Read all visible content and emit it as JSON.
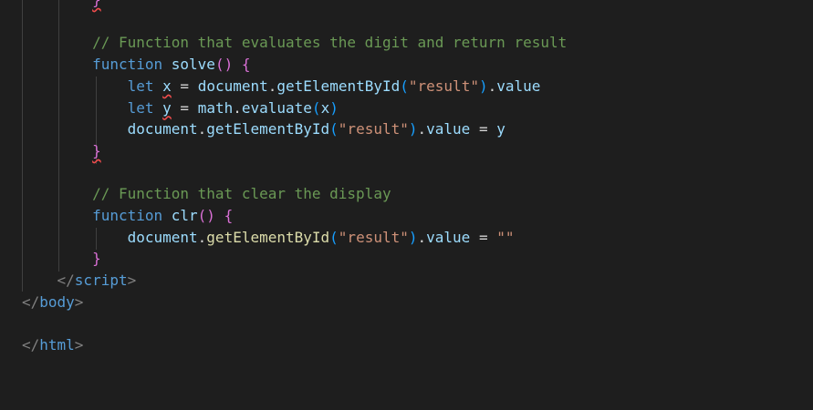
{
  "editor": {
    "lines": [
      {
        "indent": "        ",
        "tokens": [
          {
            "t": "}",
            "c": "br1 squig"
          }
        ]
      },
      {
        "indent": "",
        "tokens": []
      },
      {
        "indent": "        ",
        "tokens": [
          {
            "t": "// Function that evaluates the digit and return result",
            "c": "cm"
          }
        ]
      },
      {
        "indent": "        ",
        "tokens": [
          {
            "t": "function",
            "c": "kw"
          },
          {
            "t": " ",
            "c": "op"
          },
          {
            "t": "solve",
            "c": "var"
          },
          {
            "t": "()",
            "c": "br1"
          },
          {
            "t": " ",
            "c": "op"
          },
          {
            "t": "{",
            "c": "br1"
          }
        ]
      },
      {
        "indent": "            ",
        "tokens": [
          {
            "t": "let",
            "c": "kw"
          },
          {
            "t": " ",
            "c": "op"
          },
          {
            "t": "x",
            "c": "var squig"
          },
          {
            "t": " = ",
            "c": "op"
          },
          {
            "t": "document",
            "c": "var"
          },
          {
            "t": ".",
            "c": "op"
          },
          {
            "t": "getElementById",
            "c": "var"
          },
          {
            "t": "(",
            "c": "br2"
          },
          {
            "t": "\"result\"",
            "c": "str"
          },
          {
            "t": ")",
            "c": "br2"
          },
          {
            "t": ".",
            "c": "op"
          },
          {
            "t": "value",
            "c": "var"
          }
        ]
      },
      {
        "indent": "            ",
        "tokens": [
          {
            "t": "let",
            "c": "kw"
          },
          {
            "t": " ",
            "c": "op"
          },
          {
            "t": "y",
            "c": "var squig"
          },
          {
            "t": " = ",
            "c": "op"
          },
          {
            "t": "math",
            "c": "var"
          },
          {
            "t": ".",
            "c": "op"
          },
          {
            "t": "evaluate",
            "c": "var"
          },
          {
            "t": "(",
            "c": "br2"
          },
          {
            "t": "x",
            "c": "var"
          },
          {
            "t": ")",
            "c": "br2"
          }
        ]
      },
      {
        "indent": "            ",
        "tokens": [
          {
            "t": "document",
            "c": "var"
          },
          {
            "t": ".",
            "c": "op"
          },
          {
            "t": "getElementById",
            "c": "var"
          },
          {
            "t": "(",
            "c": "br2"
          },
          {
            "t": "\"result\"",
            "c": "str"
          },
          {
            "t": ")",
            "c": "br2"
          },
          {
            "t": ".",
            "c": "op"
          },
          {
            "t": "value",
            "c": "var"
          },
          {
            "t": " = ",
            "c": "op"
          },
          {
            "t": "y",
            "c": "var"
          }
        ]
      },
      {
        "indent": "        ",
        "tokens": [
          {
            "t": "}",
            "c": "br1 squig"
          }
        ]
      },
      {
        "indent": "",
        "tokens": []
      },
      {
        "indent": "        ",
        "tokens": [
          {
            "t": "// Function that clear the display",
            "c": "cm"
          }
        ]
      },
      {
        "indent": "        ",
        "tokens": [
          {
            "t": "function",
            "c": "kw"
          },
          {
            "t": " ",
            "c": "op"
          },
          {
            "t": "clr",
            "c": "var"
          },
          {
            "t": "()",
            "c": "br1"
          },
          {
            "t": " ",
            "c": "op"
          },
          {
            "t": "{",
            "c": "br1"
          }
        ]
      },
      {
        "indent": "            ",
        "tokens": [
          {
            "t": "document",
            "c": "var"
          },
          {
            "t": ".",
            "c": "op"
          },
          {
            "t": "getElementById",
            "c": "fn"
          },
          {
            "t": "(",
            "c": "br2"
          },
          {
            "t": "\"result\"",
            "c": "str"
          },
          {
            "t": ")",
            "c": "br2"
          },
          {
            "t": ".",
            "c": "op"
          },
          {
            "t": "value",
            "c": "var"
          },
          {
            "t": " = ",
            "c": "op"
          },
          {
            "t": "\"\"",
            "c": "str"
          }
        ]
      },
      {
        "indent": "        ",
        "tokens": [
          {
            "t": "}",
            "c": "br1"
          }
        ]
      },
      {
        "indent": "    ",
        "tokens": [
          {
            "t": "</",
            "c": "tag"
          },
          {
            "t": "script",
            "c": "tagname"
          },
          {
            "t": ">",
            "c": "tag"
          }
        ]
      },
      {
        "indent": "",
        "tokens": [
          {
            "t": "</",
            "c": "tag"
          },
          {
            "t": "body",
            "c": "tagname"
          },
          {
            "t": ">",
            "c": "tag"
          }
        ]
      },
      {
        "indent": "",
        "tokens": []
      },
      {
        "indent": "",
        "tokens": [
          {
            "t": "</",
            "c": "tag"
          },
          {
            "t": "html",
            "c": "tagname"
          },
          {
            "t": ">",
            "c": "tag"
          }
        ]
      }
    ]
  }
}
